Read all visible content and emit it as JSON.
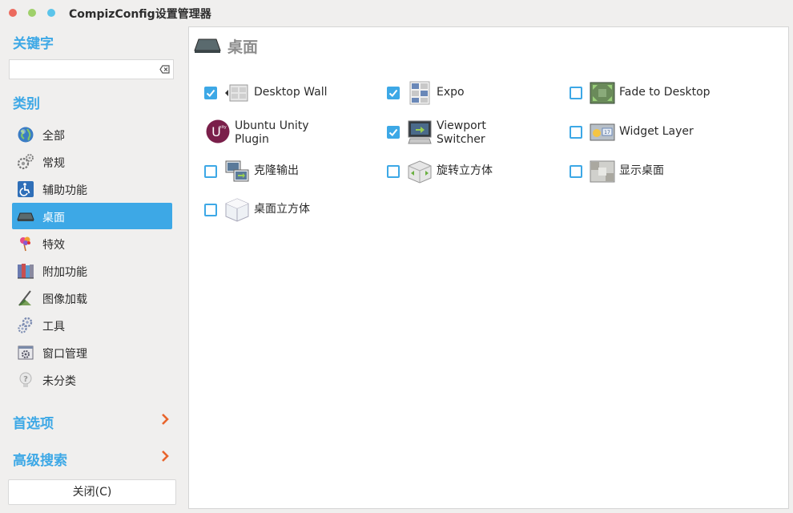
{
  "window": {
    "title": "CompizConfig设置管理器"
  },
  "sidebar": {
    "keyword_heading": "关键字",
    "search": {
      "value": "",
      "placeholder": ""
    },
    "category_heading": "类别",
    "categories": [
      {
        "label": "全部",
        "icon": "globe-icon",
        "selected": false
      },
      {
        "label": "常规",
        "icon": "gears-icon",
        "selected": false
      },
      {
        "label": "辅助功能",
        "icon": "accessibility-icon",
        "selected": false
      },
      {
        "label": "桌面",
        "icon": "desktop-icon",
        "selected": true
      },
      {
        "label": "特效",
        "icon": "effects-icon",
        "selected": false
      },
      {
        "label": "附加功能",
        "icon": "books-icon",
        "selected": false
      },
      {
        "label": "图像加载",
        "icon": "image-icon",
        "selected": false
      },
      {
        "label": "工具",
        "icon": "tools-icon",
        "selected": false
      },
      {
        "label": "窗口管理",
        "icon": "window-icon",
        "selected": false
      },
      {
        "label": "未分类",
        "icon": "question-icon",
        "selected": false
      }
    ],
    "preferences_label": "首选项",
    "advanced_search_label": "高级搜索",
    "close_label": "关闭(C)"
  },
  "main": {
    "title": "桌面",
    "plugins": [
      {
        "label": "Desktop Wall",
        "checked": true,
        "checkbox": true,
        "icon": "desktop-wall-icon"
      },
      {
        "label": "Expo",
        "checked": true,
        "checkbox": true,
        "icon": "expo-icon"
      },
      {
        "label": "Fade to Desktop",
        "checked": false,
        "checkbox": true,
        "icon": "fade-to-desktop-icon"
      },
      {
        "label": "Ubuntu Unity Plugin",
        "checked": false,
        "checkbox": false,
        "icon": "unity-icon"
      },
      {
        "label": "Viewport Switcher",
        "checked": true,
        "checkbox": true,
        "icon": "viewport-switcher-icon"
      },
      {
        "label": "Widget Layer",
        "checked": false,
        "checkbox": true,
        "icon": "widget-layer-icon"
      },
      {
        "label": "克隆输出",
        "checked": false,
        "checkbox": true,
        "icon": "clone-output-icon"
      },
      {
        "label": "旋转立方体",
        "checked": false,
        "checkbox": true,
        "icon": "rotate-cube-icon"
      },
      {
        "label": "显示桌面",
        "checked": false,
        "checkbox": true,
        "icon": "show-desktop-icon"
      },
      {
        "label": "桌面立方体",
        "checked": false,
        "checkbox": true,
        "icon": "desktop-cube-icon"
      }
    ]
  },
  "colors": {
    "accent": "#3da8e6",
    "chevron": "#e8642c",
    "selected_text": "#ffffff"
  }
}
